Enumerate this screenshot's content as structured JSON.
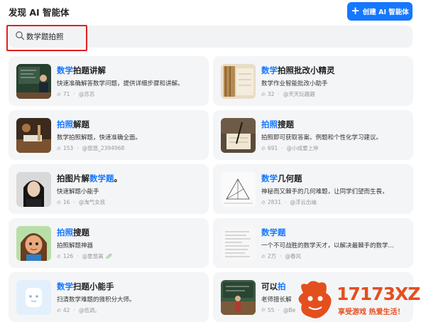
{
  "header": {
    "title": "发现 AI 智能体",
    "create_label": "创建 AI 智能体"
  },
  "search": {
    "value": "数学题拍照"
  },
  "cards": [
    {
      "title_hl": "数学",
      "title_rest": "拍题讲解",
      "title_tail": "",
      "desc": "快速准确解答数学问题，提供详细步骤和讲解。",
      "count": "71",
      "author": "@苏苏"
    },
    {
      "title_hl": "数学",
      "title_rest": "拍照批改小精灵",
      "title_tail": "",
      "desc": "数学作业智能批改小助手",
      "count": "32",
      "author": "@天天玩趣趣"
    },
    {
      "title_hl": "拍照",
      "title_rest": "解题",
      "title_tail": "",
      "desc": "数学拍照解题，快速准确全面。",
      "count": "153",
      "author": "@悠悠_2394968"
    },
    {
      "title_hl": "拍照",
      "title_rest": "搜题",
      "title_tail": "",
      "desc": "拍照即可获取答案、例题和个性化学习建议。",
      "count": "691",
      "author": "@小成要上岸"
    },
    {
      "title_pre": "拍图片解",
      "title_hl": "数学题",
      "title_rest": "。",
      "desc": "快速解题小能手",
      "count": "16",
      "author": "@淘气女孩"
    },
    {
      "title_hl": "数学",
      "title_rest": "几何题",
      "title_tail": "",
      "desc": "神秘而又棘手的几何难题，让同学们望而生畏，",
      "count": "2831",
      "author": "@浮云出岫"
    },
    {
      "title_hl": "拍照",
      "title_rest": "搜题",
      "title_tail": "",
      "desc": "拍照解题神器",
      "count": "126",
      "author": "@夏悠离"
    },
    {
      "title_hl": "数学题",
      "title_rest": "",
      "title_tail": "",
      "desc": "一个不可战胜的数学天才，以解决最棘手的数学…",
      "count": "2万",
      "author": "@春风"
    },
    {
      "title_hl": "数学",
      "title_rest": "扫题小能手",
      "title_tail": "",
      "desc": "扫清数学难题的微积分大师。",
      "count": "42",
      "author": "@低调。"
    },
    {
      "title_pre": "可以",
      "title_hl": "拍",
      "title_rest": "",
      "desc": "老师擅长解",
      "count": "55",
      "author": "@Be"
    }
  ],
  "watermark": {
    "brand": "17173XZ",
    "slogan": "享受游戏 热爱生活！"
  },
  "colors": {
    "accent": "#1677ff",
    "highlight_border": "#e02020",
    "card_bg": "#f4f5f7"
  }
}
